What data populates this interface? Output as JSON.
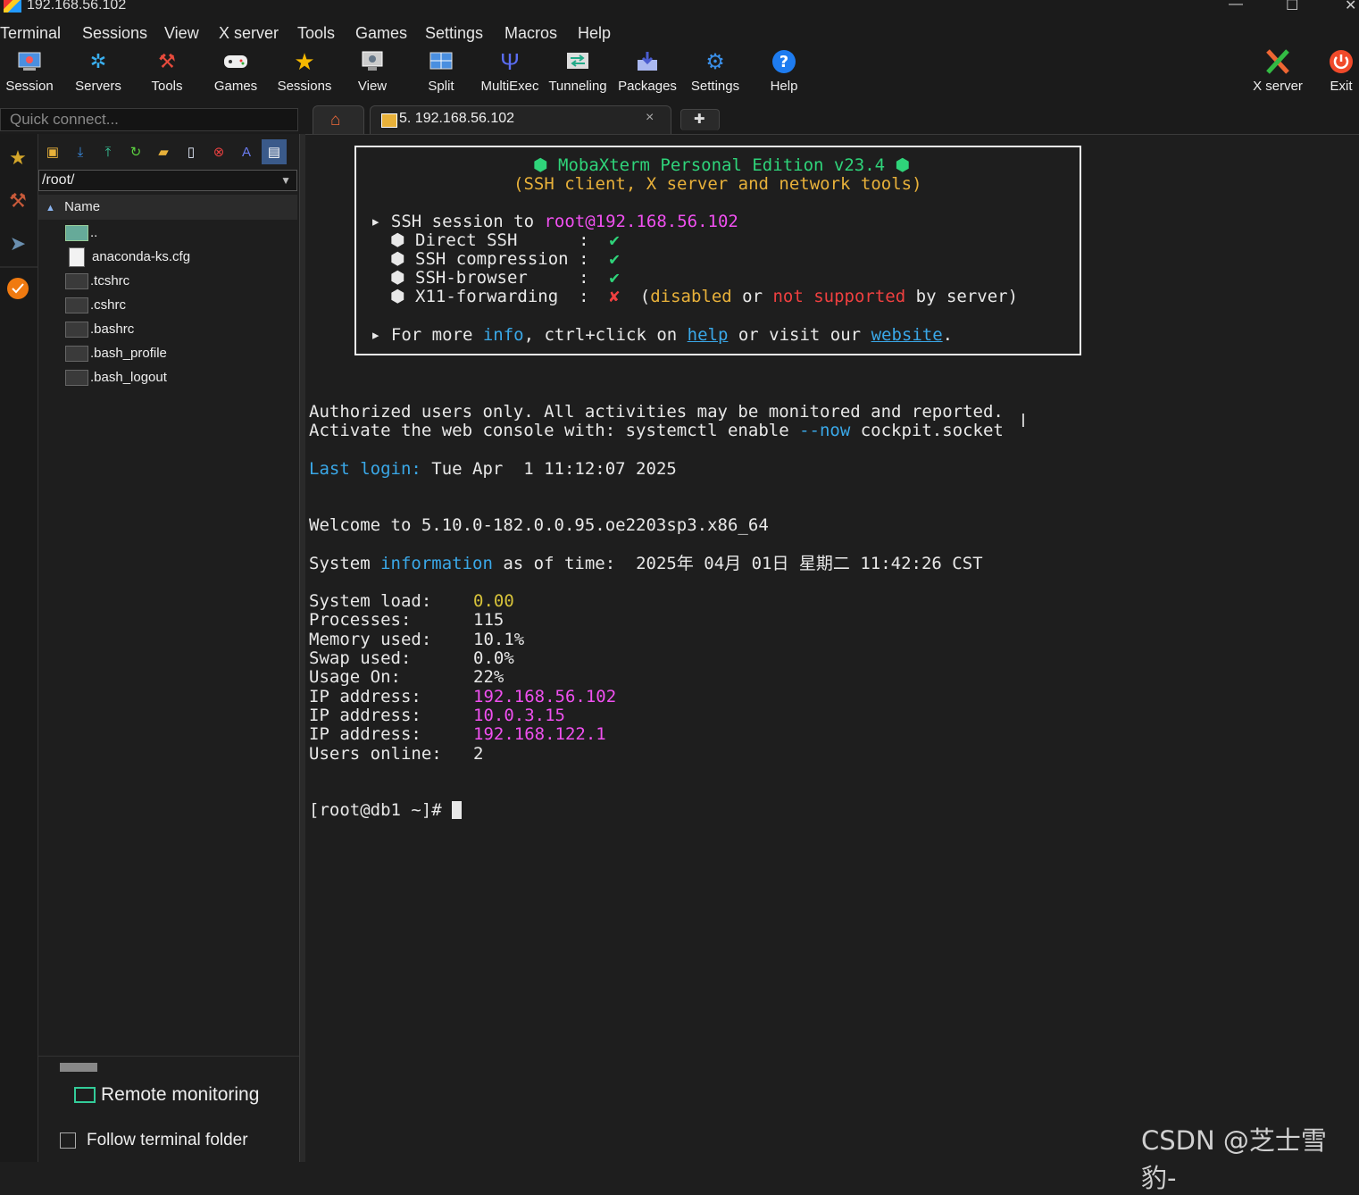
{
  "window": {
    "title": "192.168.56.102",
    "minimize": "—",
    "maximize": "☐",
    "close": "✕"
  },
  "menu": [
    "Terminal",
    "Sessions",
    "View",
    "X server",
    "Tools",
    "Games",
    "Settings",
    "Macros",
    "Help"
  ],
  "toolbar": [
    {
      "label": "Session",
      "icon": "session-icon"
    },
    {
      "label": "Servers",
      "icon": "servers-icon"
    },
    {
      "label": "Tools",
      "icon": "tools-icon"
    },
    {
      "label": "Games",
      "icon": "gamepad-icon"
    },
    {
      "label": "Sessions",
      "icon": "star-icon"
    },
    {
      "label": "View",
      "icon": "view-icon"
    },
    {
      "label": "Split",
      "icon": "split-icon"
    },
    {
      "label": "MultiExec",
      "icon": "multiexec-icon"
    },
    {
      "label": "Tunneling",
      "icon": "tunneling-icon"
    },
    {
      "label": "Packages",
      "icon": "packages-icon"
    },
    {
      "label": "Settings",
      "icon": "gear-icon"
    },
    {
      "label": "Help",
      "icon": "help-icon"
    },
    {
      "label": "X server",
      "icon": "x-server-icon"
    },
    {
      "label": "Exit",
      "icon": "power-icon"
    }
  ],
  "quick_connect": {
    "placeholder": "Quick connect..."
  },
  "tabs": {
    "session_tab": "5. 192.168.56.102",
    "close": "×",
    "add": "✚"
  },
  "sftp": {
    "path": "/root/",
    "column": "Name",
    "files": [
      "..",
      "anaconda-ks.cfg",
      ".tcshrc",
      ".cshrc",
      ".bashrc",
      ".bash_profile",
      ".bash_logout"
    ],
    "remote_monitoring": "Remote monitoring",
    "follow_terminal_folder": "Follow terminal folder"
  },
  "banner": {
    "title": "MobaXterm Personal Edition v23.4",
    "subtitle": "(SSH client, X server and network tools)",
    "session_prefix": "SSH session to ",
    "session_target": "root@192.168.56.102",
    "features": [
      {
        "name": "Direct SSH      ",
        "status": "✔"
      },
      {
        "name": "SSH compression ",
        "status": "✔"
      },
      {
        "name": "SSH-browser     ",
        "status": "✔"
      },
      {
        "name": "X11-forwarding  ",
        "status": "✘"
      }
    ],
    "x11_note_a": "(",
    "x11_note_disabled": "disabled",
    "x11_note_or": " or ",
    "x11_note_ns": "not supported",
    "x11_note_end": " by server)",
    "more_a": "For more ",
    "more_info": "info",
    "more_b": ", ctrl+click on ",
    "more_help": "help",
    "more_c": " or visit our ",
    "more_website": "website",
    "more_d": "."
  },
  "terminal": {
    "authorized": "Authorized users only. All activities may be monitored and reported.",
    "activate_a": "Activate the web console with: systemctl enable ",
    "activate_now": "--now",
    "activate_b": " cockpit.socket",
    "last_login_label": "Last login:",
    "last_login_value": " Tue Apr  1 11:12:07 2025",
    "welcome": "Welcome to 5.10.0-182.0.0.95.oe2203sp3.x86_64",
    "sysinfo_a": "System ",
    "sysinfo_info": "information",
    "sysinfo_b": " as of time:  2025年 04月 01日 星期二 11:42:26 CST",
    "stats": [
      {
        "label": "System load:",
        "value": "0.00",
        "color": "#d6c23a"
      },
      {
        "label": "Processes:",
        "value": "115",
        "color": "#e8e8e8"
      },
      {
        "label": "Memory used:",
        "value": "10.1%",
        "color": "#e8e8e8"
      },
      {
        "label": "Swap used:",
        "value": "0.0%",
        "color": "#e8e8e8"
      },
      {
        "label": "Usage On:",
        "value": "22%",
        "color": "#e8e8e8"
      },
      {
        "label": "IP address:",
        "value": "192.168.56.102",
        "color": "#f050f0"
      },
      {
        "label": "IP address:",
        "value": "10.0.3.15",
        "color": "#f050f0"
      },
      {
        "label": "IP address:",
        "value": "192.168.122.1",
        "color": "#f050f0"
      },
      {
        "label": "Users online:",
        "value": "2",
        "color": "#e8e8e8"
      }
    ],
    "prompt": "[root@db1 ~]# "
  },
  "watermark": "CSDN @芝士雪豹-",
  "ibeam": "I"
}
